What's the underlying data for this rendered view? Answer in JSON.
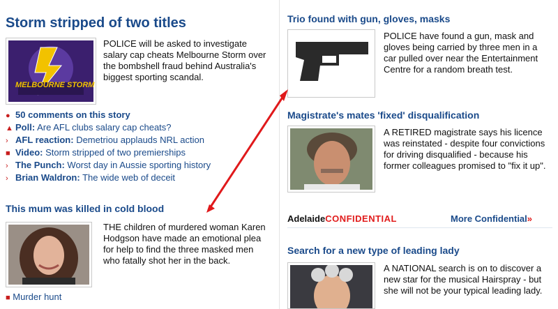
{
  "left": {
    "headline": "Storm stripped of two titles",
    "story": "POLICE will be asked to investigate salary cap cheats Melbourne Storm over the bombshell fraud behind Australia's biggest sporting scandal.",
    "logo_text": "MELBOURNE STORM",
    "links": [
      {
        "icon": "comment-icon",
        "label": "50 comments on this story",
        "text": ""
      },
      {
        "icon": "poll-icon",
        "label": "Poll:",
        "text": "Are AFL clubs salary cap cheats?"
      },
      {
        "icon": "arrow-right-icon",
        "label": "AFL reaction:",
        "text": "Demetriou applauds NRL action"
      },
      {
        "icon": "video-icon",
        "label": "Video:",
        "text": "Storm stripped of two premierships"
      },
      {
        "icon": "arrow-right-icon",
        "label": "The Punch:",
        "text": "Worst day in Aussie sporting history"
      },
      {
        "icon": "arrow-right-icon",
        "label": "Brian Waldron:",
        "text": "The wide web of deceit"
      }
    ],
    "story2_headline": "This mum was killed in cold blood",
    "story2": "THE children of murdered woman Karen Hodgson have made an emotional plea for help to find the three masked men who fatally shot her in the back.",
    "story2_link": "Murder hunt"
  },
  "right": {
    "s1_headline": "Trio found with gun, gloves, masks",
    "s1_text": "POLICE have found a gun, mask and gloves being carried by three men in a car pulled over near the Entertainment Centre for a random breath test.",
    "s2_headline": "Magistrate's mates 'fixed' disqualification",
    "s2_text": "A RETIRED magistrate says his licence was reinstated - despite four convictions for driving disqualified - because his former colleagues promised to \"fix it up\".",
    "adelaide": "Adelaide",
    "confidential": "CONFIDENTIAL",
    "more": "More Confidential",
    "more_arrow": "»",
    "s3_headline": "Search for a new type of leading lady",
    "s3_text": "A NATIONAL search is on to discover a new star for the musical Hairspray - but she will not be your typical leading lady."
  },
  "colors": {
    "link_blue": "#1a4a8a",
    "accent_red": "#e11d1d",
    "annotation_arrow": "#e0191b"
  }
}
